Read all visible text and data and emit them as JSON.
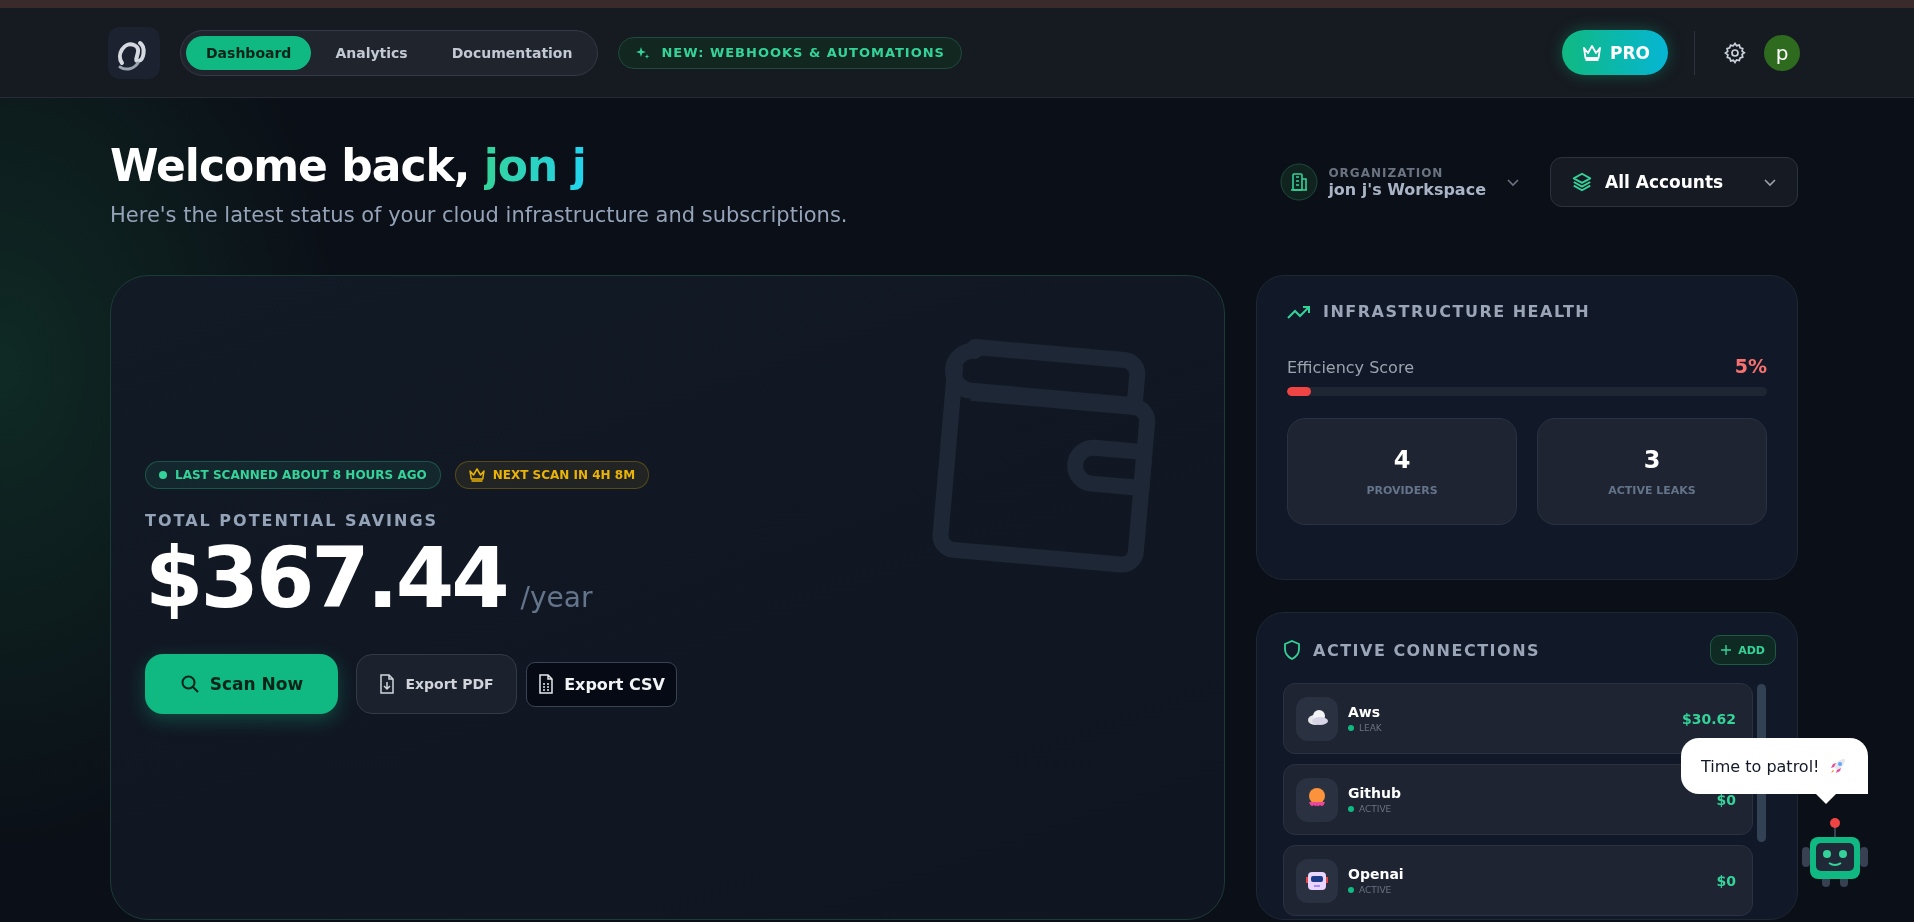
{
  "nav": {
    "tabs": [
      {
        "label": "Dashboard",
        "selected": true
      },
      {
        "label": "Analytics",
        "selected": false
      },
      {
        "label": "Documentation",
        "selected": false
      }
    ]
  },
  "announcement": "NEW: WEBHOOKS & AUTOMATIONS",
  "pro_button": "PRO",
  "avatar": "p",
  "welcome": {
    "greeting": "Welcome back,",
    "name": "jon j",
    "subtitle": "Here's the latest status of your cloud infrastructure and subscriptions."
  },
  "organization": {
    "label": "ORGANIZATION",
    "value": "jon j's Workspace"
  },
  "account_select": {
    "value": "All Accounts"
  },
  "savings": {
    "badges": [
      {
        "kind": "dot",
        "text": "LAST SCANNED ABOUT 8 HOURS AGO",
        "color": "#34d399"
      },
      {
        "kind": "crown",
        "text": "NEXT SCAN IN 4H 8M",
        "color": "#eab308"
      }
    ],
    "label": "TOTAL POTENTIAL SAVINGS",
    "amount": "$367.44",
    "period": "/year",
    "buttons": [
      {
        "kind": "primary",
        "label": "Scan Now"
      },
      {
        "kind": "secondary",
        "label": "Export PDF"
      },
      {
        "kind": "outline",
        "label": "Export CSV"
      }
    ]
  },
  "health": {
    "title": "INFRASTRUCTURE HEALTH",
    "score_label": "Efficiency Score",
    "score": "5%",
    "level": 0.05,
    "stats": [
      {
        "value": "4",
        "label": "PROVIDERS"
      },
      {
        "value": "3",
        "label": "ACTIVE LEAKS"
      }
    ]
  },
  "connections": {
    "title": "ACTIVE CONNECTIONS",
    "add": "ADD",
    "items": [
      {
        "kind": "cloud",
        "name": "Aws",
        "status": "LEAK",
        "amount": "$30.62"
      },
      {
        "kind": "octopus",
        "name": "Github",
        "status": "ACTIVE",
        "amount": "$0"
      },
      {
        "kind": "robot",
        "name": "Openai",
        "status": "ACTIVE",
        "amount": "$0"
      }
    ]
  },
  "assistant": {
    "message": "Time to patrol!"
  }
}
